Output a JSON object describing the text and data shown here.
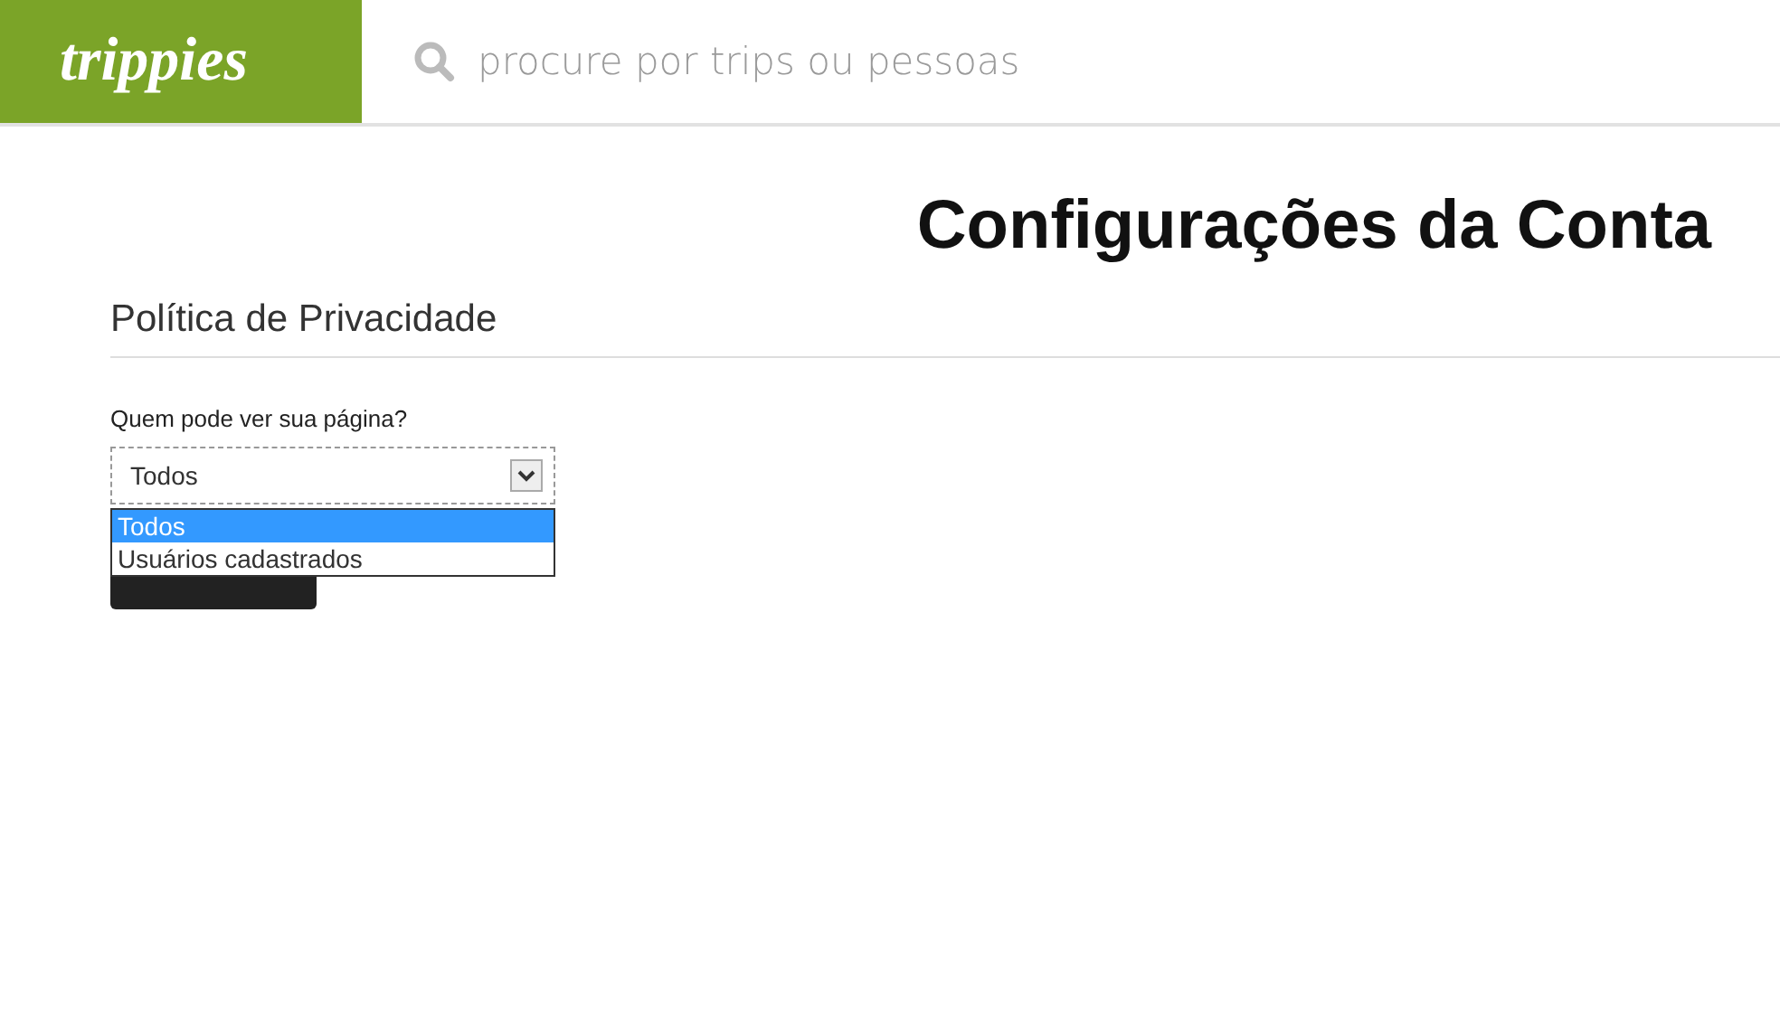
{
  "header": {
    "logo": "trippies",
    "search": {
      "placeholder": "procure por trips ou pessoas"
    }
  },
  "page_title": "Configurações da Conta",
  "section": {
    "title": "Política de Privacidade",
    "field": {
      "label": "Quem pode ver sua página?",
      "value": "Todos",
      "expanded": true,
      "options": [
        {
          "label": "Todos",
          "selected": true
        },
        {
          "label": "Usuários cadastrados",
          "selected": false
        }
      ]
    }
  }
}
